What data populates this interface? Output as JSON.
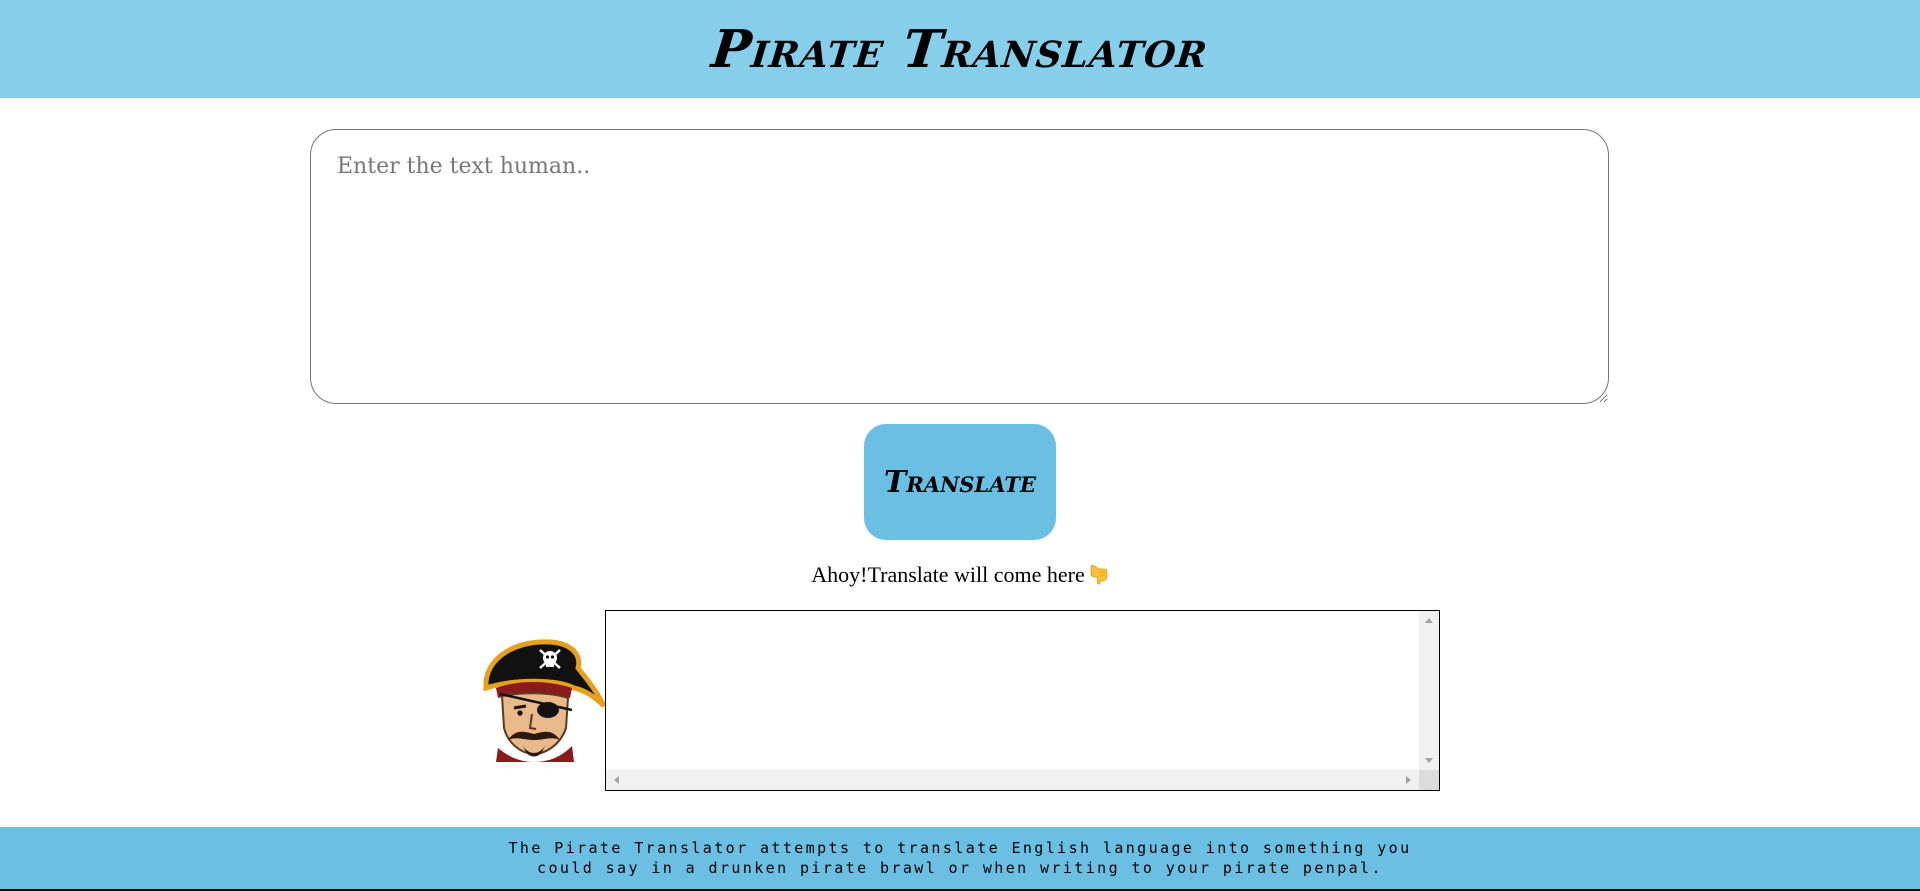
{
  "header": {
    "title": "Pirate Translator"
  },
  "input": {
    "placeholder": "Enter the text human..",
    "value": ""
  },
  "translate_button": {
    "label": "Translate"
  },
  "output": {
    "label": "Ahoy!Translate will come here",
    "label_icon": "pointing-down-icon",
    "value": ""
  },
  "avatar": {
    "icon": "pirate-avatar-icon"
  },
  "footer": {
    "text": "The Pirate Translator attempts to translate English language into something you could say in a drunken pirate brawl or when writing to your pirate penpal."
  },
  "colors": {
    "header_bg": "#87ceeb",
    "button_bg": "#6bbfe3",
    "footer_bg": "#6bbfe3"
  }
}
